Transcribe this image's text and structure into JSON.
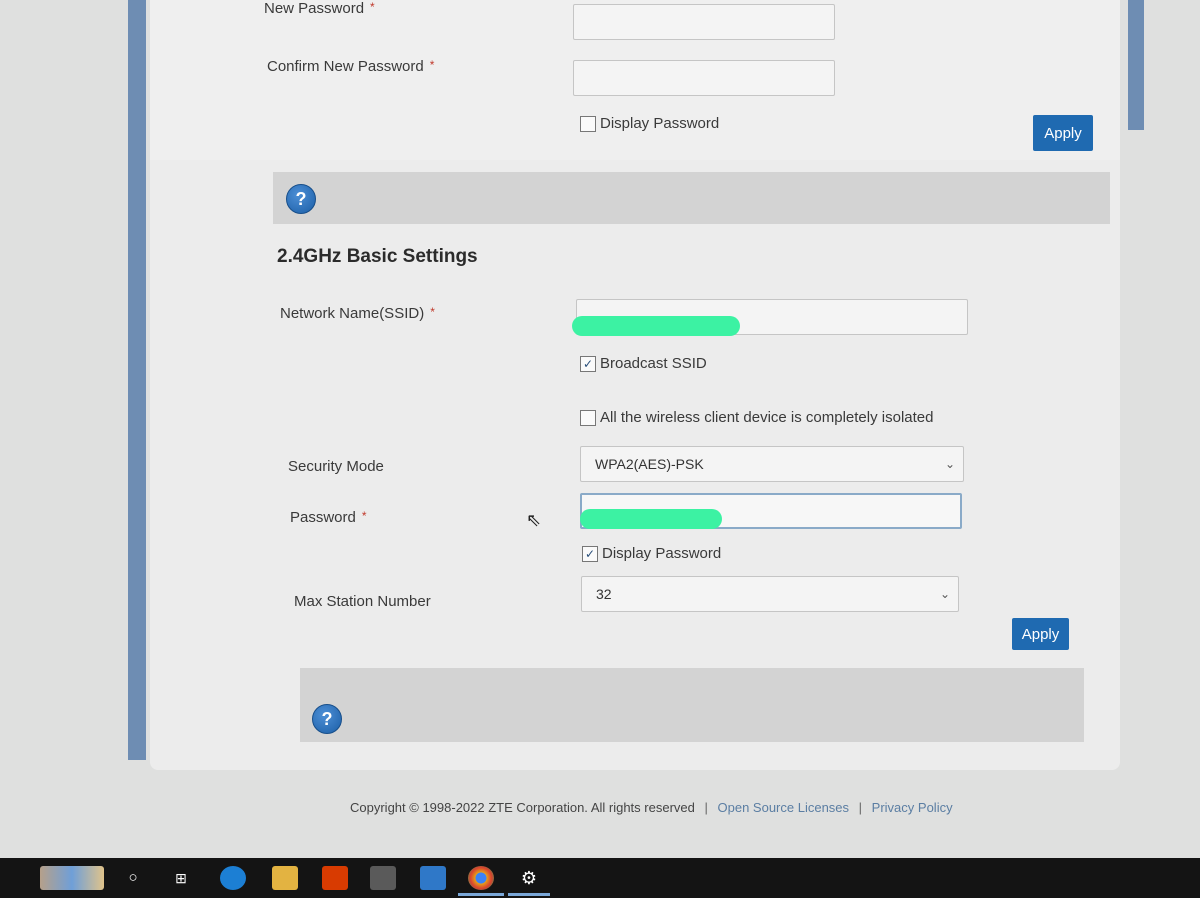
{
  "password_section": {
    "new_password_label": "New Password",
    "confirm_password_label": "Confirm New Password",
    "required_mark": "*",
    "display_password_label": "Display Password",
    "display_password_checked": false,
    "apply_label": "Apply",
    "help_glyph": "?"
  },
  "basic_settings": {
    "title": "2.4GHz Basic Settings",
    "ssid_label": "Network Name(SSID)",
    "required_mark": "*",
    "broadcast_ssid_label": "Broadcast SSID",
    "broadcast_ssid_checked": true,
    "isolation_label": "All the wireless client device is completely isolated",
    "isolation_checked": false,
    "security_mode_label": "Security Mode",
    "security_mode_value": "WPA2(AES)-PSK",
    "password_label": "Password",
    "display_password_label": "Display Password",
    "display_password_checked": true,
    "max_station_label": "Max Station Number",
    "max_station_value": "32",
    "apply_label": "Apply",
    "help_glyph": "?"
  },
  "footer": {
    "copyright": "Copyright © 1998-2022 ZTE Corporation. All rights reserved",
    "separator": "|",
    "open_source_link": "Open Source Licenses",
    "privacy_link": "Privacy Policy"
  },
  "icons": {
    "check": "✓",
    "chevron": "⌄",
    "cursor": "⇖",
    "gear": "⚙"
  },
  "colors": {
    "apply_button": "#1f6ab1",
    "help_icon": "#1b5ea6",
    "redaction": "#3cf2a3"
  }
}
